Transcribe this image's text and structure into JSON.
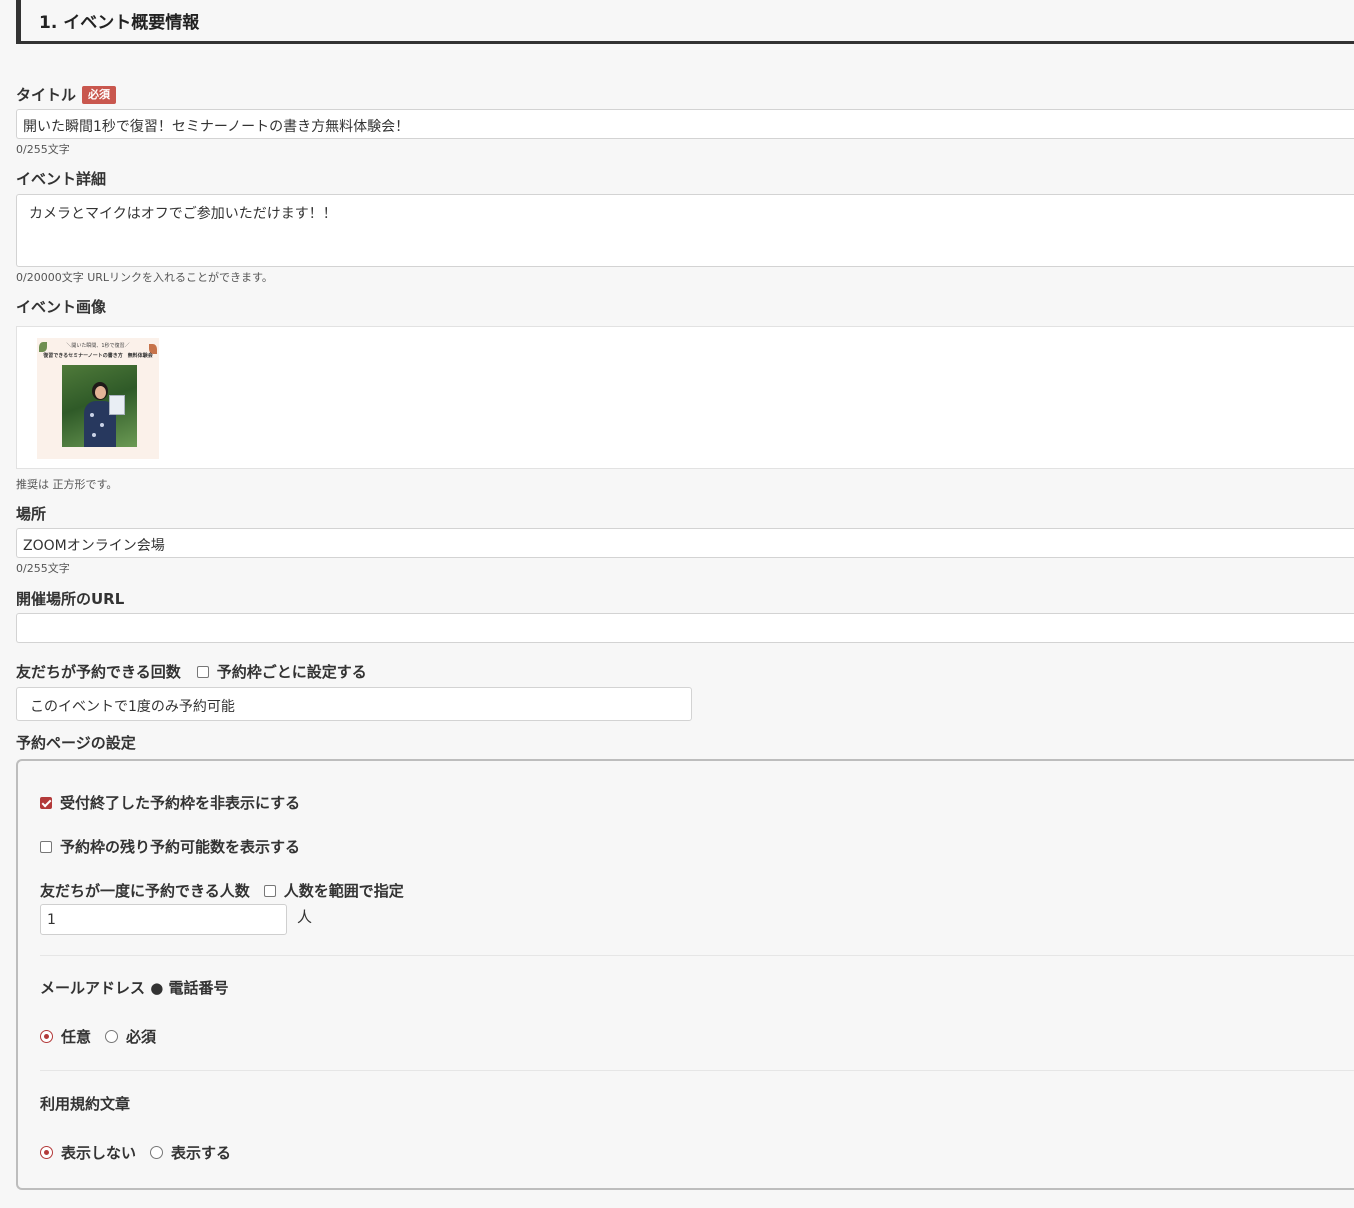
{
  "section": {
    "title": "1. イベント概要情報"
  },
  "title_field": {
    "label": "タイトル",
    "required_badge": "必須",
    "value": "開いた瞬間1秒で復習！セミナーノートの書き方無料体験会！",
    "counter": "0/255文字"
  },
  "detail_field": {
    "label": "イベント詳細",
    "value": "カメラとマイクはオフでご参加いただけます！！",
    "helper": "0/20000文字 URLリンクを入れることができます。"
  },
  "image_field": {
    "label": "イベント画像",
    "thumb_line1": "＼開いた瞬間、1秒で復習／",
    "thumb_line2": "復習できるセミナーノートの書き方　無料体験会",
    "helper": "推奨は 正方形です。"
  },
  "location_field": {
    "label": "場所",
    "value": "ZOOMオンライン会場",
    "counter": "0/255文字"
  },
  "url_field": {
    "label": "開催場所のURL",
    "value": ""
  },
  "reserve_count": {
    "label": "友だちが予約できる回数",
    "per_slot_label": "予約枠ごとに設定する",
    "per_slot_checked": false,
    "selected": "このイベントで1度のみ予約可能"
  },
  "page_settings": {
    "label": "予約ページの設定",
    "hide_closed_label": "受付終了した予約枠を非表示にする",
    "hide_closed_checked": true,
    "show_remaining_label": "予約枠の残り予約可能数を表示する",
    "show_remaining_checked": false,
    "people_label": "友だちが一度に予約できる人数",
    "range_label": "人数を範囲で指定",
    "range_checked": false,
    "people_value": "1",
    "people_unit": "人",
    "contact_label": "メールアドレス ● 電話番号",
    "contact_options": [
      "任意",
      "必須"
    ],
    "contact_selected": "任意",
    "terms_label": "利用規約文章",
    "terms_options": [
      "表示しない",
      "表示する"
    ],
    "terms_selected": "表示しない"
  },
  "colors": {
    "accent": "#b33a3a",
    "badge": "#c9574e"
  }
}
